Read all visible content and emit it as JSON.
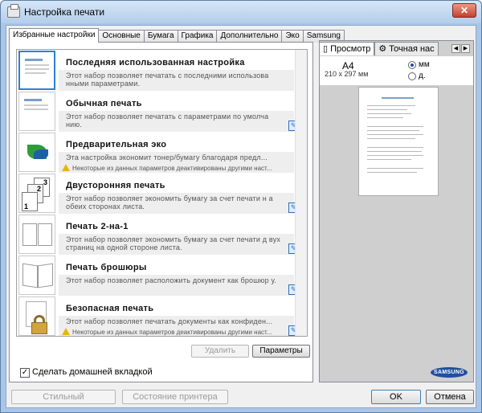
{
  "window": {
    "title": "Настройка печати",
    "close": "✕"
  },
  "tabs": [
    "Избранные настройки",
    "Основные",
    "Бумага",
    "Графика",
    "Дополнительно",
    "Эко",
    "Samsung"
  ],
  "presets": [
    {
      "name": "Последняя использованная настройка",
      "desc": "Этот набор позволяет печатать с последними использова нными параметрами.",
      "warning": ""
    },
    {
      "name": "Обычная печать",
      "desc": "Этот набор позволяет печатать с параметрами по умолча нию.",
      "warning": ""
    },
    {
      "name": "Предварительная эко",
      "desc": "Эта настройка экономит тонер/бумагу благодаря предл...",
      "warning": "Некоторые из данных параметров деактивированы другими наст..."
    },
    {
      "name": "Двусторонняя печать",
      "desc": "Этот набор позволяет экономить бумагу за счет печати н а обеих сторонах листа.",
      "warning": ""
    },
    {
      "name": "Печать 2-на-1",
      "desc": "Этот набор позволяет экономить бумагу за счет печати д вух страниц на одной стороне листа.",
      "warning": ""
    },
    {
      "name": "Печать брошюры",
      "desc": "Этот набор позволяет расположить документ как брошюр у.",
      "warning": ""
    },
    {
      "name": "Безопасная печать",
      "desc": "Этот набор позволяет печатать документы как конфиден...",
      "warning": "Некоторые из данных параметров деактивированы другими наст..."
    }
  ],
  "buttons": {
    "delete": "Удалить",
    "params": "Параметры",
    "style": "Стильный",
    "printer_status": "Состояние принтера",
    "ok": "OK",
    "cancel": "Отмена"
  },
  "default_tab_label": "Сделать домашней вкладкой",
  "preview": {
    "tab1": "Просмотр",
    "tab2": "Точная нас",
    "paper": "A4",
    "dims": "210 x 297 мм",
    "unit_mm": "мм",
    "unit_in": "д."
  },
  "brand": "SAMSUNG"
}
